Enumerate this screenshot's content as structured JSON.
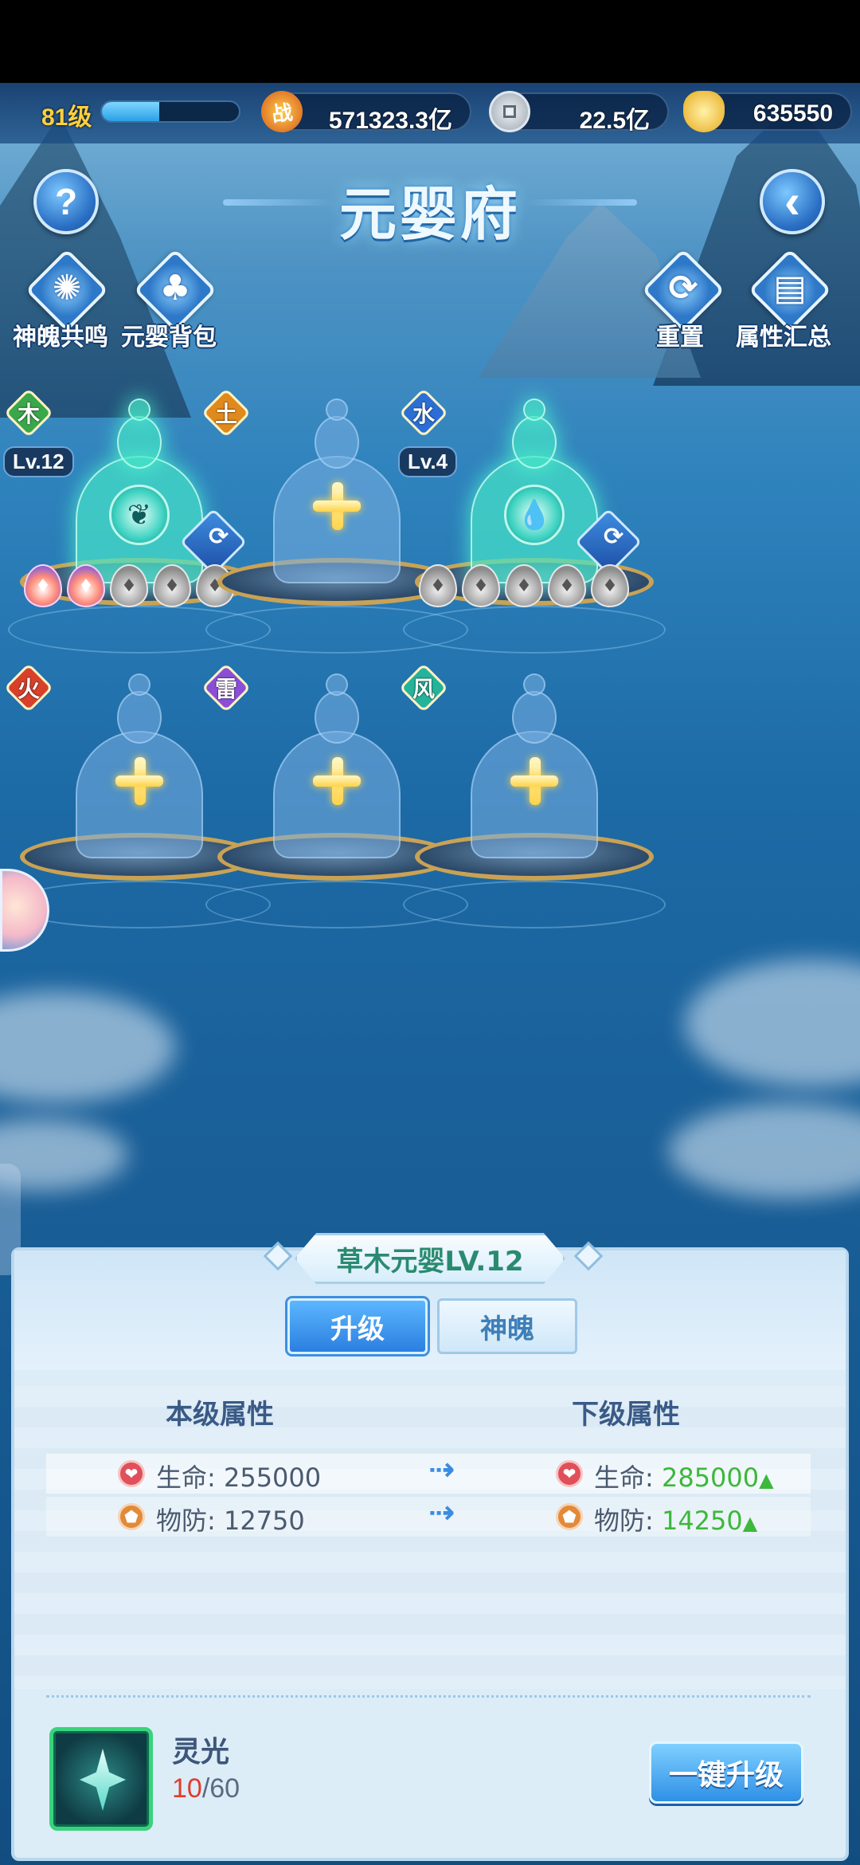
{
  "player": {
    "level_label": "81级",
    "xp_fraction": 0.42
  },
  "resources": {
    "power": "571323.3亿",
    "power_icon": "战",
    "silver": "22.5亿",
    "gold": "635550"
  },
  "page": {
    "title": "元婴府"
  },
  "buttons": {
    "help": "?",
    "back": "‹",
    "soul_resonance": "神魄共鸣",
    "yuanying_bag": "元婴背包",
    "reset": "重置",
    "attr_summary": "属性汇总"
  },
  "slots": [
    {
      "element": "木",
      "element_color": "#3aa84a",
      "level": "Lv.12",
      "state": "active",
      "orb": "❦",
      "gems_lit": 2
    },
    {
      "element": "土",
      "element_color": "#e08a1e",
      "state": "empty"
    },
    {
      "element": "水",
      "element_color": "#2b6fd6",
      "level": "Lv.4",
      "state": "active",
      "orb": "💧",
      "gems_lit": 0
    },
    {
      "element": "火",
      "element_color": "#d8402a",
      "state": "empty"
    },
    {
      "element": "雷",
      "element_color": "#8b4fd6",
      "state": "empty"
    },
    {
      "element": "风",
      "element_color": "#25b39a",
      "state": "empty"
    }
  ],
  "panel": {
    "title": "草木元婴LV.12",
    "tabs": [
      "升级",
      "神魄"
    ],
    "current_header": "本级属性",
    "next_header": "下级属性",
    "rows": [
      {
        "icon": "heart-icon",
        "label": "生命:",
        "current": "255000",
        "next": "285000"
      },
      {
        "icon": "shield-icon",
        "label": "物防:",
        "current": "12750",
        "next": "14250"
      }
    ],
    "item": {
      "name": "灵光",
      "have": "10",
      "need": "/60"
    },
    "upgrade_all": "一键升级"
  },
  "colors": {
    "accent": "#2f90e6",
    "positive": "#3cb83a",
    "insufficient": "#e23b2b"
  }
}
